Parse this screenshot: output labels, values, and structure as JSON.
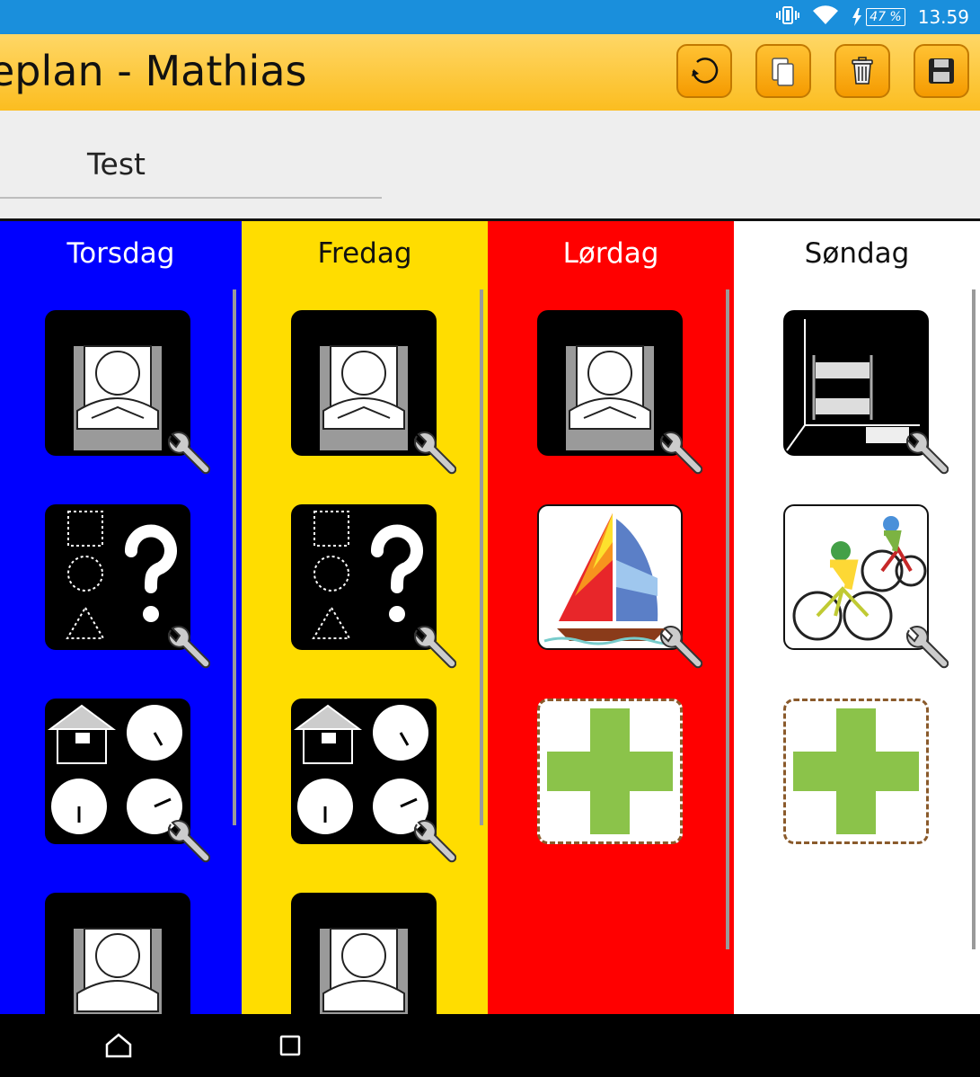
{
  "status": {
    "battery": "47 %",
    "time": "13.59"
  },
  "app": {
    "title": "eplan - Mathias"
  },
  "toolbar": [
    "undo-icon",
    "copy-icon",
    "trash-icon",
    "save-icon"
  ],
  "tab": {
    "label": "Test"
  },
  "days": [
    {
      "name": "Torsdag",
      "bg": "#0000ff",
      "text": "#ffffff",
      "tiles": [
        {
          "kind": "pictogram",
          "icon": "sleep-in-bed-icon",
          "edit": true
        },
        {
          "kind": "pictogram",
          "icon": "shapes-question-icon",
          "edit": true
        },
        {
          "kind": "pictogram",
          "icon": "school-clocks-icon",
          "edit": true
        },
        {
          "kind": "pictogram",
          "icon": "sleep-in-bed-icon",
          "edit": true
        }
      ]
    },
    {
      "name": "Fredag",
      "bg": "#ffdd00",
      "text": "#111111",
      "tiles": [
        {
          "kind": "pictogram",
          "icon": "sleep-in-bed-icon",
          "edit": true
        },
        {
          "kind": "pictogram",
          "icon": "shapes-question-icon",
          "edit": true
        },
        {
          "kind": "pictogram",
          "icon": "school-clocks-icon",
          "edit": true
        },
        {
          "kind": "pictogram",
          "icon": "sleep-in-bed-icon",
          "edit": true
        }
      ]
    },
    {
      "name": "Lørdag",
      "bg": "#ff0000",
      "text": "#ffffff",
      "tiles": [
        {
          "kind": "pictogram",
          "icon": "sleep-in-bed-icon",
          "edit": true
        },
        {
          "kind": "pictogram",
          "icon": "sailboat-icon",
          "edit": true
        },
        {
          "kind": "add",
          "icon": "add-plus-icon",
          "edit": false
        }
      ]
    },
    {
      "name": "Søndag",
      "bg": "#ffffff",
      "text": "#111111",
      "tiles": [
        {
          "kind": "pictogram",
          "icon": "bunk-bed-room-icon",
          "edit": true
        },
        {
          "kind": "pictogram",
          "icon": "cycling-icon",
          "edit": true
        },
        {
          "kind": "add",
          "icon": "add-plus-icon",
          "edit": false
        }
      ]
    }
  ],
  "nav": [
    "home-icon",
    "recents-icon"
  ]
}
